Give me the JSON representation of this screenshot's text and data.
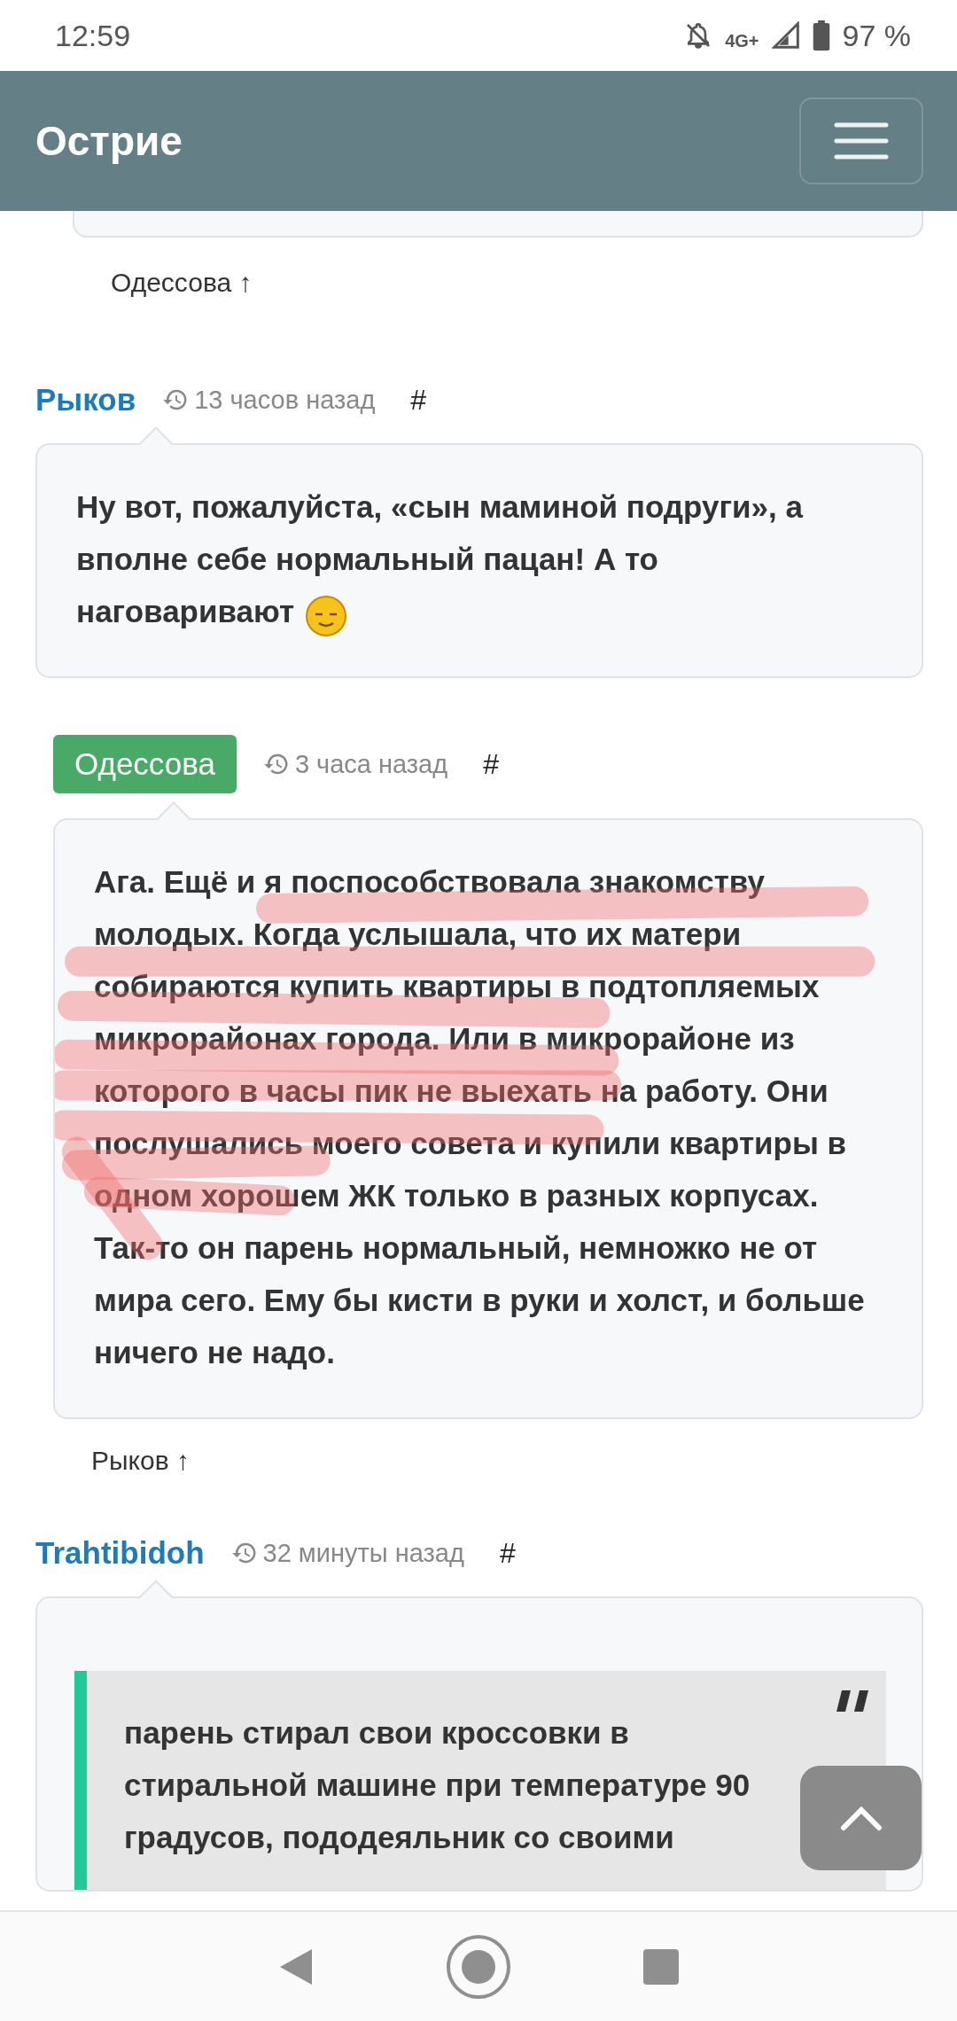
{
  "status_bar": {
    "time": "12:59",
    "network": "4G+",
    "battery": "97 %"
  },
  "header": {
    "title": "Острие"
  },
  "top_reply": {
    "label": "Одессова ↑"
  },
  "comments": [
    {
      "author": "Рыков",
      "author_highlighted": false,
      "indented": false,
      "time": "13 часов назад",
      "anchor": "#",
      "kind": "text",
      "text": "Ну вот, пожалуйста, «сын маминой подруги», а вполне себе нормальный пацан! А то наговаривают",
      "trailing_smiley": true,
      "marked": false
    },
    {
      "author": "Одессова",
      "author_highlighted": true,
      "indented": true,
      "time": "3 часа назад",
      "anchor": "#",
      "kind": "text",
      "text": "Ага. Ещё и я поспособствовала знакомству молодых. Когда услышала, что их матери собираются купить квартиры в подтопляемых микрорайонах города. Или в микрорайоне из которого в часы пик не выехать на работу. Они послушались моего совета и купили квартиры в одном хорошем ЖК только в разных корпусах. Так-то он парень нормальный, немножко не от мира сего. Ему бы кисти в руки и холст, и больше ничего не надо.",
      "trailing_smiley": false,
      "marked": true,
      "reply": "Рыков ↑"
    },
    {
      "author": "Trahtibidoh",
      "author_highlighted": false,
      "indented": false,
      "time": "32 минуты назад",
      "anchor": "#",
      "kind": "quote",
      "text": "парень стирал свои кроссовки в стиральной машине при температуре 90 градусов, пододеяльник со своими",
      "trailing_smiley": false,
      "marked": false
    }
  ]
}
